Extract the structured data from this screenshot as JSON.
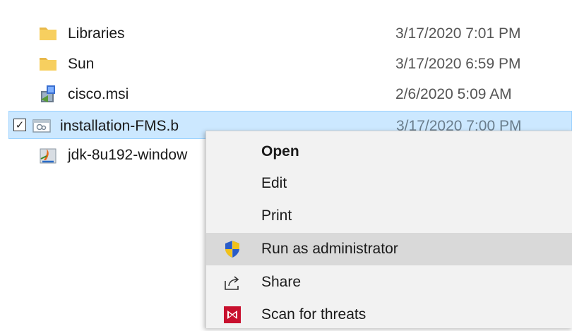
{
  "files": [
    {
      "name": "Libraries",
      "date": "3/17/2020 7:01 PM",
      "icon": "folder-icon",
      "selected": false
    },
    {
      "name": "Sun",
      "date": "3/17/2020 6:59 PM",
      "icon": "folder-icon",
      "selected": false
    },
    {
      "name": "cisco.msi",
      "date": "2/6/2020 5:09 AM",
      "icon": "msi-installer-icon",
      "selected": false
    },
    {
      "name": "installation-FMS.b",
      "date": "3/17/2020 7:00 PM",
      "icon": "batch-file-icon",
      "selected": true
    },
    {
      "name": "jdk-8u192-window",
      "date": "",
      "icon": "java-installer-icon",
      "selected": false
    }
  ],
  "context_menu": {
    "items": [
      {
        "label": "Open",
        "icon": "",
        "default": true
      },
      {
        "label": "Edit",
        "icon": ""
      },
      {
        "label": "Print",
        "icon": ""
      },
      {
        "label": "Run as administrator",
        "icon": "uac-shield-icon",
        "highlighted": true
      },
      {
        "label": "Share",
        "icon": "share-icon"
      },
      {
        "label": "Scan for threats",
        "icon": "mcafee-icon"
      }
    ]
  },
  "checkbox_glyph": "✓",
  "colors": {
    "selection_bg": "#cce8ff",
    "selection_border": "#99d1ff",
    "menu_bg": "#f2f2f2",
    "menu_hover": "#d9d9d9",
    "folder": "#f7cf5f",
    "mcafee": "#c8102e"
  }
}
